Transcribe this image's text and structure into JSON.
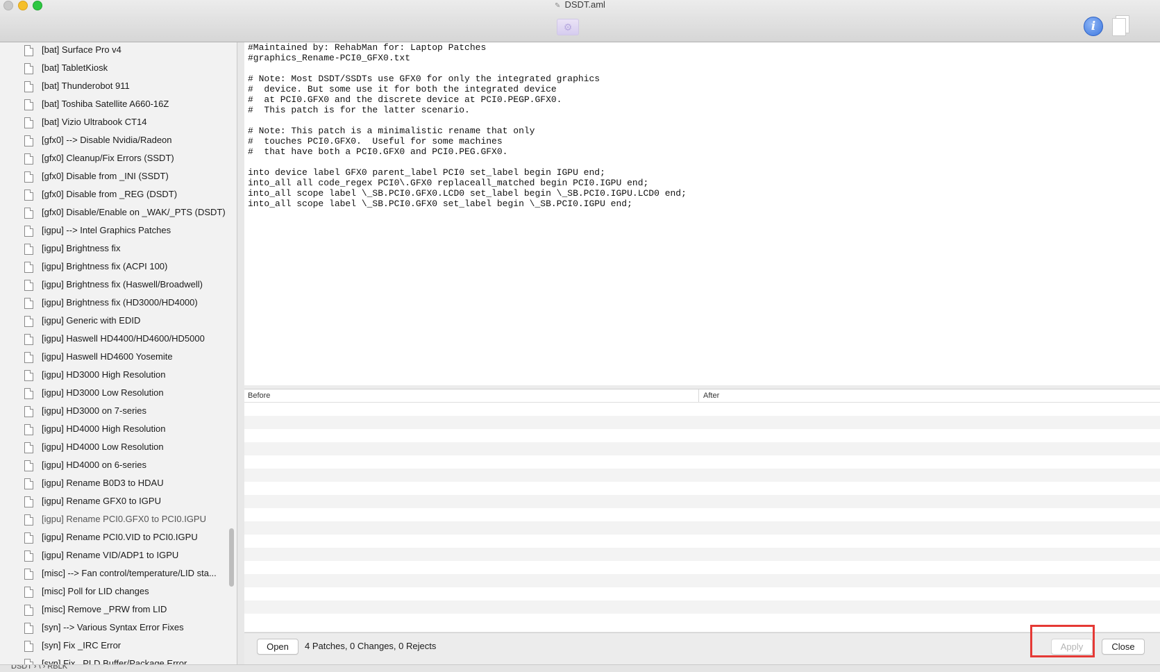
{
  "window": {
    "title": "DSDT.aml"
  },
  "sidebar": {
    "items": [
      "[bat] Surface Pro v4",
      "[bat] TabletKiosk",
      "[bat] Thunderobot 911",
      "[bat] Toshiba Satellite A660-16Z",
      "[bat] Vizio Ultrabook CT14",
      "[gfx0] --> Disable Nvidia/Radeon",
      "[gfx0] Cleanup/Fix Errors (SSDT)",
      "[gfx0] Disable from _INI (SSDT)",
      "[gfx0] Disable from _REG (DSDT)",
      "[gfx0] Disable/Enable on _WAK/_PTS (DSDT)",
      "[igpu] --> Intel Graphics Patches",
      "[igpu] Brightness fix",
      "[igpu] Brightness fix (ACPI 100)",
      "[igpu] Brightness fix (Haswell/Broadwell)",
      "[igpu] Brightness fix (HD3000/HD4000)",
      "[igpu] Generic with EDID",
      "[igpu] Haswell HD4400/HD4600/HD5000",
      "[igpu] Haswell HD4600 Yosemite",
      "[igpu] HD3000 High Resolution",
      "[igpu] HD3000 Low Resolution",
      "[igpu] HD3000 on 7-series",
      "[igpu] HD4000 High Resolution",
      "[igpu] HD4000 Low Resolution",
      "[igpu] HD4000 on 6-series",
      "[igpu] Rename B0D3 to HDAU",
      "[igpu] Rename GFX0 to IGPU",
      "[igpu] Rename PCI0.GFX0 to PCI0.IGPU",
      "[igpu] Rename PCI0.VID to PCI0.IGPU",
      "[igpu] Rename VID/ADP1 to IGPU",
      "[misc] --> Fan control/temperature/LID sta...",
      "[misc] Poll for LID changes",
      "[misc] Remove _PRW from LID",
      "[syn] --> Various Syntax Error Fixes",
      "[syn] Fix _IRC Error",
      "[syn] Fix _PLD Buffer/Package Error"
    ],
    "selected_index": 26
  },
  "statusbar": {
    "path": "DSDT › \\ › RBLK"
  },
  "editor": {
    "text": "#Maintained by: RehabMan for: Laptop Patches\n#graphics_Rename-PCI0_GFX0.txt\n\n# Note: Most DSDT/SSDTs use GFX0 for only the integrated graphics\n#  device. But some use it for both the integrated device\n#  at PCI0.GFX0 and the discrete device at PCI0.PEGP.GFX0.\n#  This patch is for the latter scenario.\n\n# Note: This patch is a minimalistic rename that only\n#  touches PCI0.GFX0.  Useful for some machines\n#  that have both a PCI0.GFX0 and PCI0.PEG.GFX0.\n\ninto device label GFX0 parent_label PCI0 set_label begin IGPU end;\ninto_all all code_regex PCI0\\.GFX0 replaceall_matched begin PCI0.IGPU end;\ninto_all scope label \\_SB.PCI0.GFX0.LCD0 set_label begin \\_SB.PCI0.IGPU.LCD0 end;\ninto_all scope label \\_SB.PCI0.GFX0 set_label begin \\_SB.PCI0.IGPU end;"
  },
  "diff": {
    "before_header": "Before",
    "after_header": "After"
  },
  "bottombar": {
    "open_label": "Open",
    "status": "4 Patches, 0 Changes, 0 Rejects",
    "apply_label": "Apply",
    "close_label": "Close"
  },
  "icons": {
    "info": "info-icon",
    "pages": "pages-icon",
    "toolbar_center": "gear-icon",
    "file": "file-icon"
  },
  "colors": {
    "highlight": "#e53935",
    "info_blue": "#3c77e0"
  }
}
